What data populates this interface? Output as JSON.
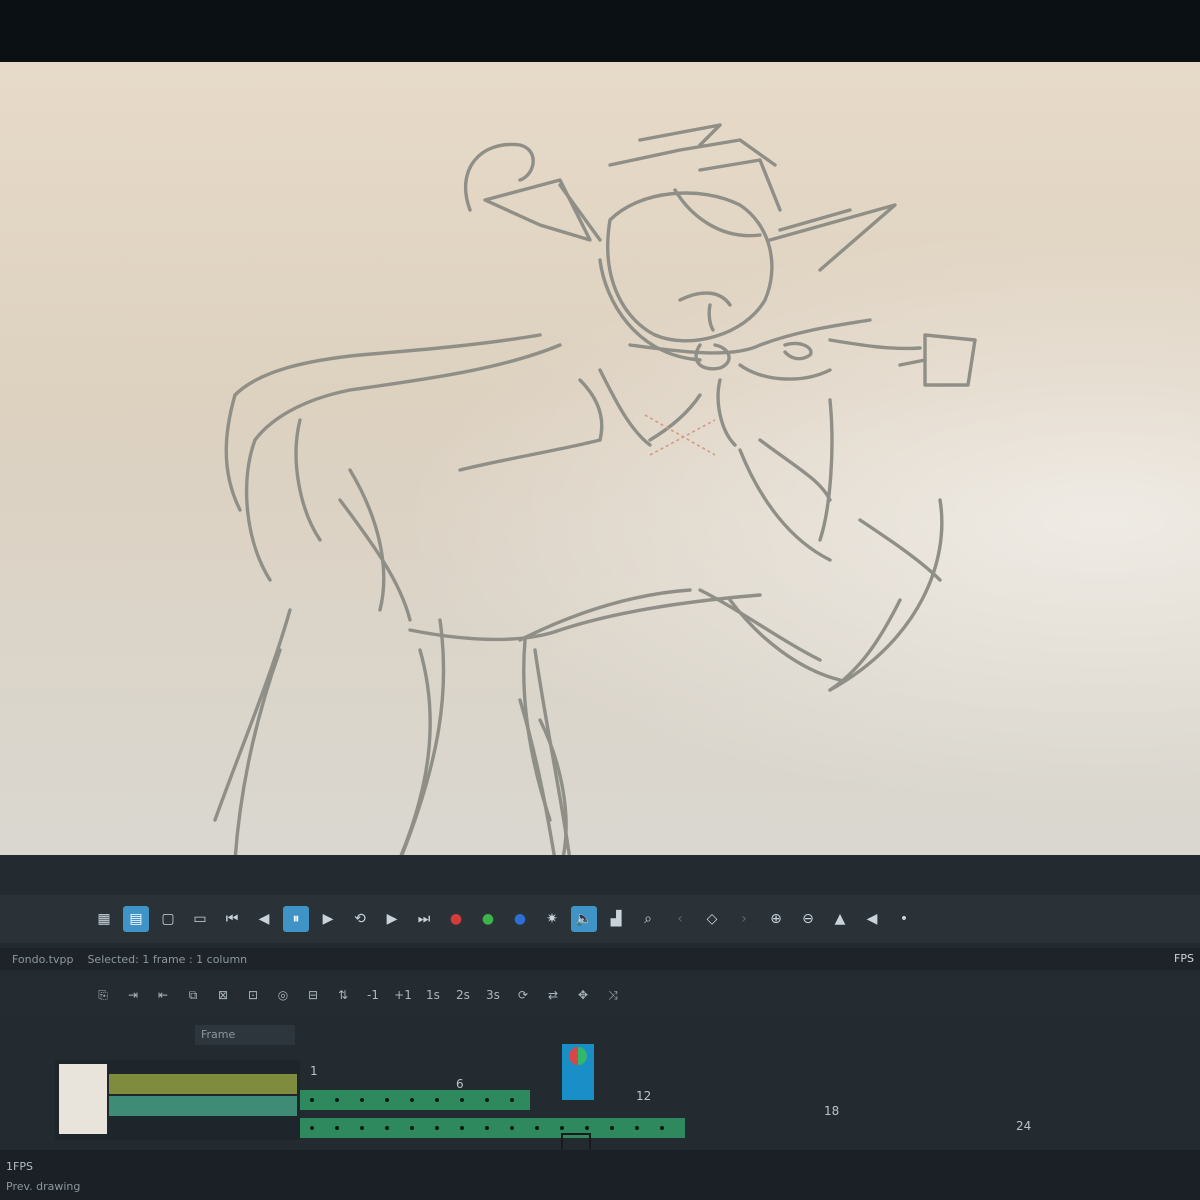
{
  "transport": {
    "buttons": [
      {
        "name": "onion-skin-icon",
        "glyph": "▦"
      },
      {
        "name": "light-table-icon",
        "glyph": "▤"
      },
      {
        "name": "grid-icon",
        "glyph": "▢"
      },
      {
        "name": "frame-icon",
        "glyph": "▭"
      },
      {
        "name": "first-frame-icon",
        "glyph": "⏮"
      },
      {
        "name": "prev-frame-icon",
        "glyph": "◀"
      },
      {
        "name": "pause-icon",
        "glyph": "⏸"
      },
      {
        "name": "play-icon",
        "glyph": "▶"
      },
      {
        "name": "loop-icon",
        "glyph": "⟲"
      },
      {
        "name": "next-frame-icon",
        "glyph": "▶"
      },
      {
        "name": "last-frame-icon",
        "glyph": "⏭"
      },
      {
        "name": "red-dot-icon",
        "glyph": "●"
      },
      {
        "name": "green-dot-icon",
        "glyph": "●"
      },
      {
        "name": "blue-dot-icon",
        "glyph": "●"
      },
      {
        "name": "settings-icon",
        "glyph": "✷"
      },
      {
        "name": "sound-icon",
        "glyph": "🔈"
      },
      {
        "name": "chart-icon",
        "glyph": "▟"
      },
      {
        "name": "search-icon",
        "glyph": "⌕"
      },
      {
        "name": "prev-key-icon",
        "glyph": "‹"
      },
      {
        "name": "keyframe-icon",
        "glyph": "◇"
      },
      {
        "name": "next-key-icon",
        "glyph": "›"
      },
      {
        "name": "zoom-in-icon",
        "glyph": "⊕"
      },
      {
        "name": "zoom-out-icon",
        "glyph": "⊖"
      },
      {
        "name": "triangle-up-icon",
        "glyph": "▲"
      },
      {
        "name": "triangle-left-icon",
        "glyph": "◀"
      },
      {
        "name": "dot-icon",
        "glyph": "•"
      }
    ],
    "active_index": 6
  },
  "status": {
    "file": "Fondo.tvpp",
    "selection": "Selected: 1 frame : 1 column",
    "fps_label": "FPS"
  },
  "tools": {
    "buttons": [
      {
        "name": "new-layer-icon",
        "glyph": "⎘"
      },
      {
        "name": "import-icon",
        "glyph": "⇥"
      },
      {
        "name": "export-icon",
        "glyph": "⇤"
      },
      {
        "name": "duplicate-icon",
        "glyph": "⧉"
      },
      {
        "name": "delete-icon",
        "glyph": "⊠"
      },
      {
        "name": "clip-icon",
        "glyph": "⊡"
      },
      {
        "name": "camera-icon",
        "glyph": "◎"
      },
      {
        "name": "trash-icon",
        "glyph": "⊟"
      },
      {
        "name": "sort-icon",
        "glyph": "⇅"
      }
    ],
    "minus_one": "-1",
    "plus_one": "+1",
    "t1": "1s",
    "t2": "2s",
    "t3": "3s"
  },
  "frame_select": "Frame",
  "timeline": {
    "ticks": [
      "1",
      "6",
      "12",
      "18",
      "24"
    ]
  },
  "bottom": {
    "fps": "1FPS",
    "drawing": "Prev. drawing"
  }
}
